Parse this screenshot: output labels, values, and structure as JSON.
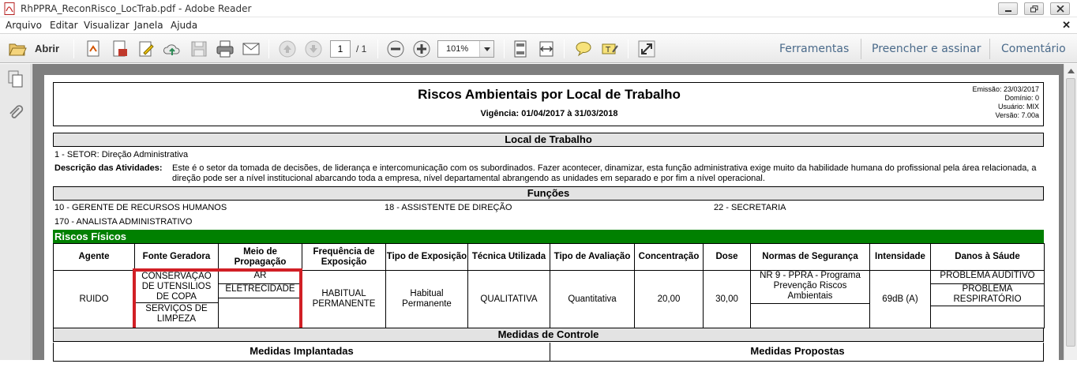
{
  "window": {
    "title": "RhPPRA_ReconRisco_LocTrab.pdf - Adobe Reader"
  },
  "menu": [
    "Arquivo",
    "Editar",
    "Visualizar",
    "Janela",
    "Ajuda"
  ],
  "toolbar": {
    "open_label": "Abrir",
    "page_current": "1",
    "page_total": "/ 1",
    "zoom": "101%",
    "right_links": [
      "Ferramentas",
      "Preencher e assinar",
      "Comentário"
    ]
  },
  "report": {
    "title": "Riscos Ambientais por Local de Trabalho",
    "vigencia": "Vigência: 01/04/2017 à 31/03/2018",
    "meta": [
      "Emissão: 23/03/2017",
      "Domínio: 0",
      "Usuário: MIX",
      "Versão: 7.00a"
    ],
    "local_header": "Local de Trabalho",
    "setor": "1 - SETOR: Direção Administrativa",
    "atividades_label": "Descrição das Atividades:",
    "atividades_text": "Este é o setor da tomada de decisões, de liderança e intercomunicação com os subordinados. Fazer acontecer, dinamizar, esta função administrativa exige muito da habilidade humana do profissional pela área relacionada, a direção pode ser a nível institucional abarcando toda a empresa, nível departamental abrangendo as unidades em separado e por fim a nível operacional.",
    "funcoes_header": "Funções",
    "funcoes": [
      "10 - GERENTE DE RECURSOS HUMANOS",
      "18 - ASSISTENTE DE DIREÇÃO",
      "22 - SECRETARIA",
      "170 - ANALISTA ADMINISTRATIVO"
    ],
    "riscos_header": "Riscos Físicos",
    "columns": [
      "Agente",
      "Fonte Geradora",
      "Meio de Propagação",
      "Frequência de Exposição",
      "Tipo de Exposição",
      "Técnica Utilizada",
      "Tipo de Avaliação",
      "Concentração",
      "Dose",
      "Normas de Segurança",
      "Intensidade",
      "Danos à Sáude"
    ],
    "row": {
      "agente": "RUIDO",
      "fontes": [
        "CONSERVAÇÃO DE UTENSILIOS DE COPA",
        "SERVIÇOS DE LIMPEZA"
      ],
      "meios": [
        "AR",
        "ELETRECIDADE",
        ""
      ],
      "frequencia": "HABITUAL PERMANENTE",
      "tipo_exposicao": "Habitual Permanente",
      "tecnica": "QUALITATIVA",
      "tipo_avaliacao": "Quantitativa",
      "concentracao": "20,00",
      "dose": "30,00",
      "normas": [
        "NR 9 - PPRA - Programa Prevenção Riscos Ambientais",
        ""
      ],
      "intensidade": "69dB (A)",
      "danos": [
        "PROBLEMA AUDITIVO",
        "PROBLEMA RESPIRATÓRIO",
        ""
      ]
    },
    "medidas_header": "Medidas de Controle",
    "medidas_implantadas": "Medidas Implantadas",
    "medidas_propostas": "Medidas Propostas"
  },
  "colors": {
    "green_band": "#008000",
    "highlight": "#d11f25",
    "link": "#4a6a8a"
  }
}
